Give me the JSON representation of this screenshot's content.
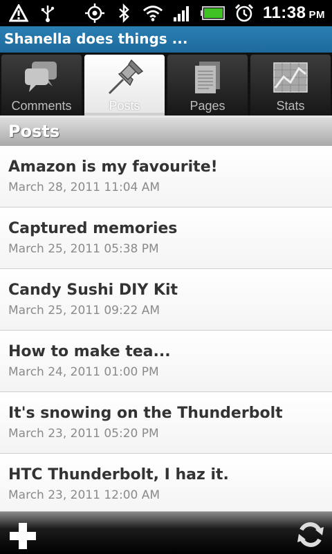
{
  "status_bar": {
    "time": "11:38",
    "ampm": "PM",
    "icons": [
      "warning-icon",
      "usb-icon",
      "gps-icon",
      "bluetooth-icon",
      "wifi-icon",
      "signal-icon",
      "battery-icon",
      "alarm-icon"
    ],
    "battery_color": "#3ec224"
  },
  "title_bar": {
    "title": "Shanella does things ..."
  },
  "tabs": [
    {
      "label": "Comments",
      "icon": "comments-icon",
      "active": false
    },
    {
      "label": "Posts",
      "icon": "pushpin-icon",
      "active": true
    },
    {
      "label": "Pages",
      "icon": "pages-icon",
      "active": false
    },
    {
      "label": "Stats",
      "icon": "stats-icon",
      "active": false
    }
  ],
  "section": {
    "title": "Posts"
  },
  "posts": [
    {
      "title": "Amazon is my favourite!",
      "date": "March 28, 2011 11:04 AM"
    },
    {
      "title": "Captured memories",
      "date": "March 25, 2011 05:38 PM"
    },
    {
      "title": "Candy Sushi DIY Kit",
      "date": "March 25, 2011 09:22 AM"
    },
    {
      "title": "How to make tea...",
      "date": "March 24, 2011 01:00 PM"
    },
    {
      "title": "It's snowing on the Thunderbolt",
      "date": "March 23, 2011 05:20 PM"
    },
    {
      "title": "HTC Thunderbolt, I haz it.",
      "date": "March 23, 2011 12:00 AM"
    }
  ],
  "bottom_bar": {
    "add_icon": "plus-icon",
    "refresh_icon": "refresh-icon"
  },
  "colors": {
    "title_bar": "#2a7fb3",
    "active_tab": "#ffffff",
    "accent_header": "#a9a9a9"
  }
}
